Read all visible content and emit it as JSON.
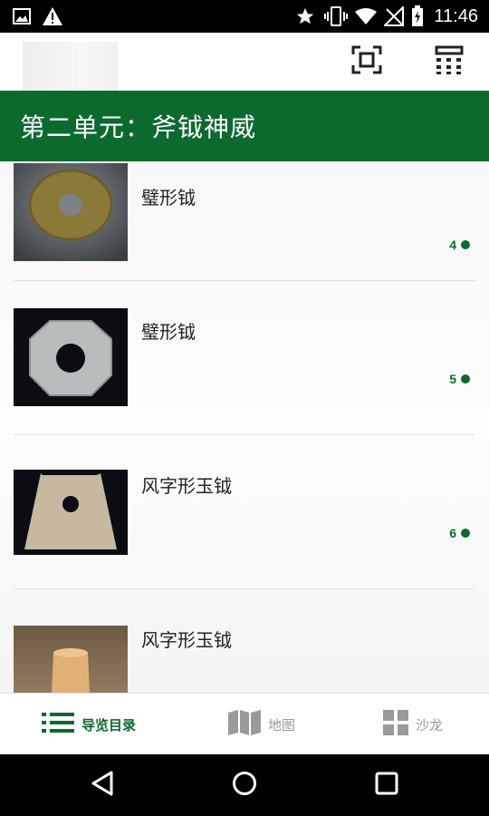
{
  "status_bar": {
    "time": "11:46",
    "icons": [
      "image-icon",
      "warning-icon",
      "star-icon",
      "vibrate-icon",
      "wifi-icon",
      "no-signal-icon",
      "battery-charging-icon"
    ]
  },
  "toolbar": {
    "back": "back-arrow-icon",
    "scan": "scan-icon",
    "keypad": "keypad-icon"
  },
  "section": {
    "title": "第二单元：斧钺神威"
  },
  "items": [
    {
      "title": "璧形钺",
      "number": "4"
    },
    {
      "title": "璧形钺",
      "number": "5"
    },
    {
      "title": "风字形玉钺",
      "number": "6"
    },
    {
      "title": "风字形玉钺",
      "number": ""
    }
  ],
  "bottom_nav": [
    {
      "label": "导览目录",
      "icon": "list-icon",
      "active": true
    },
    {
      "label": "地图",
      "icon": "map-icon",
      "active": false
    },
    {
      "label": "沙龙",
      "icon": "grid-icon",
      "active": false
    }
  ],
  "colors": {
    "accent": "#0c6a2f"
  }
}
